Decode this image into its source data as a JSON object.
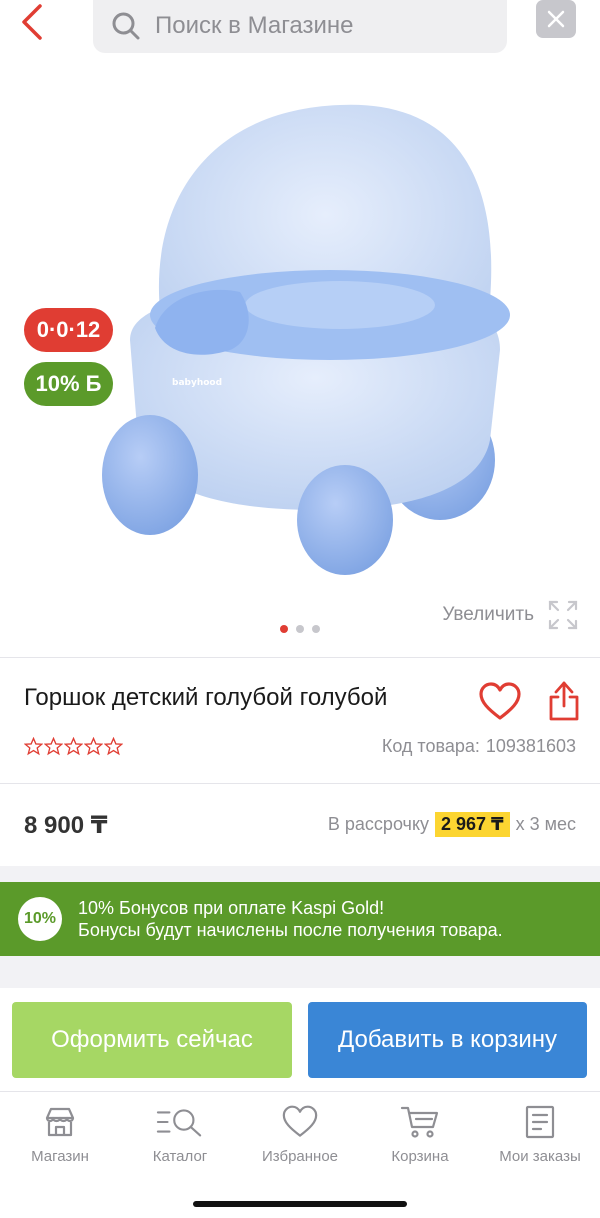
{
  "search": {
    "placeholder": "Поиск в Магазине"
  },
  "gallery": {
    "badges": {
      "installment": "0·0·12",
      "bonus": "10% Б"
    },
    "zoom_label": "Увеличить",
    "slides_count": 3,
    "active_slide": 1,
    "image_logo_text": "babyhood"
  },
  "product": {
    "title": "Горшок детский голубой голубой",
    "rating_stars": 0,
    "sku_label": "Код товара:",
    "sku_value": "109381603"
  },
  "price": {
    "value": "8 900 ₸",
    "installment_prefix": "В рассрочку",
    "installment_amount": "2 967 ₸",
    "installment_suffix": "х 3 мес"
  },
  "bonus": {
    "circle": "10%",
    "line1": "10% Бонусов при оплате Kaspi Gold!",
    "line2": "Бонусы будут начислены после получения товара."
  },
  "actions": {
    "buy_now": "Оформить сейчас",
    "add_to_cart": "Добавить в корзину"
  },
  "nav": {
    "items": [
      {
        "label": "Магазин",
        "icon": "store-icon"
      },
      {
        "label": "Каталог",
        "icon": "catalog-icon"
      },
      {
        "label": "Избранное",
        "icon": "heart-icon"
      },
      {
        "label": "Корзина",
        "icon": "cart-icon"
      },
      {
        "label": "Мои заказы",
        "icon": "orders-icon"
      }
    ]
  },
  "colors": {
    "accent_red": "#e03d33",
    "bonus_green": "#5b9a2a",
    "buy_green": "#a6d764",
    "cart_blue": "#3a86d6",
    "installment_yellow": "#fcd531"
  }
}
